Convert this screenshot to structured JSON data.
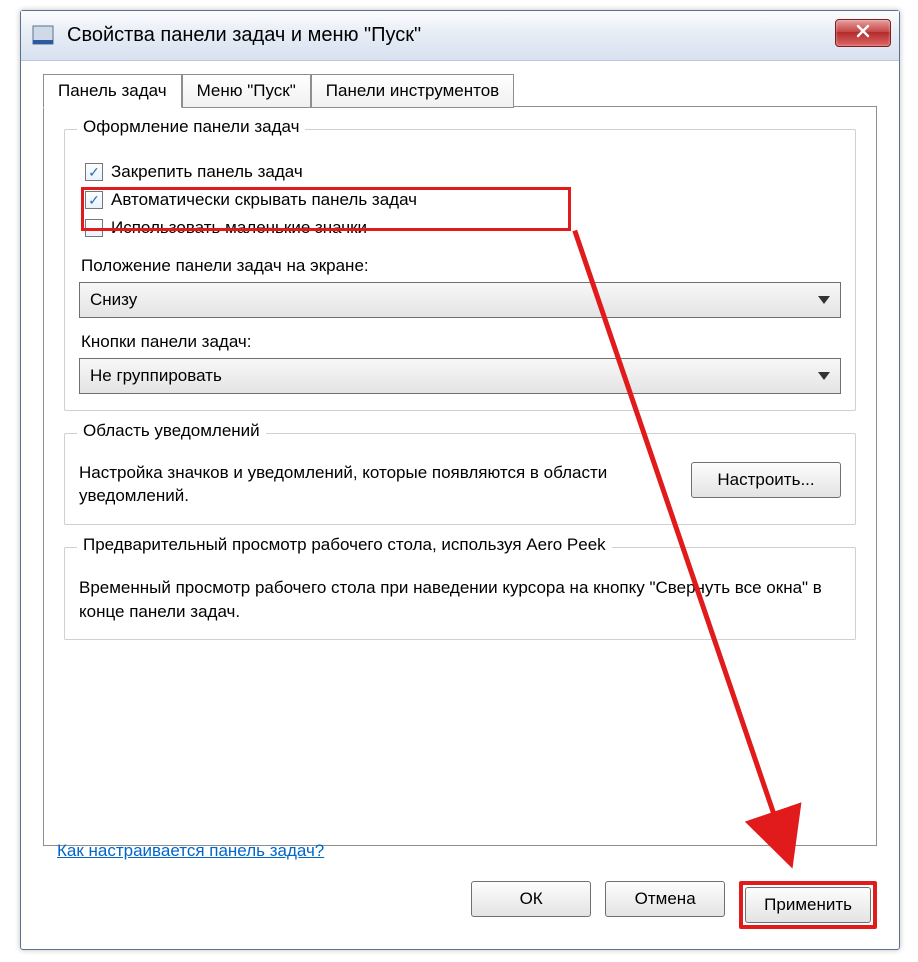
{
  "window": {
    "title": "Свойства панели задач и меню \"Пуск\""
  },
  "tabs": [
    {
      "label": "Панель задач",
      "active": true
    },
    {
      "label": "Меню \"Пуск\"",
      "active": false
    },
    {
      "label": "Панели инструментов",
      "active": false
    }
  ],
  "group_appearance": {
    "legend": "Оформление панели задач",
    "checkbox_lock": "Закрепить панель задач",
    "checkbox_autohide": "Автоматически скрывать панель задач",
    "checkbox_small": "Использовать маленькие значки",
    "label_position": "Положение панели задач на экране:",
    "combo_position": "Снизу",
    "label_buttons": "Кнопки панели задач:",
    "combo_buttons": "Не группировать"
  },
  "group_notification": {
    "legend": "Область уведомлений",
    "text": "Настройка значков и уведомлений, которые появляются в области уведомлений.",
    "button": "Настроить..."
  },
  "group_aero": {
    "legend": "Предварительный просмотр рабочего стола, используя Aero Peek",
    "text": "Временный просмотр рабочего стола при наведении курсора на кнопку \"Свернуть все окна\" в конце панели задач."
  },
  "help_link": "Как настраивается панель задач?",
  "buttons": {
    "ok": "ОК",
    "cancel": "Отмена",
    "apply": "Применить"
  }
}
